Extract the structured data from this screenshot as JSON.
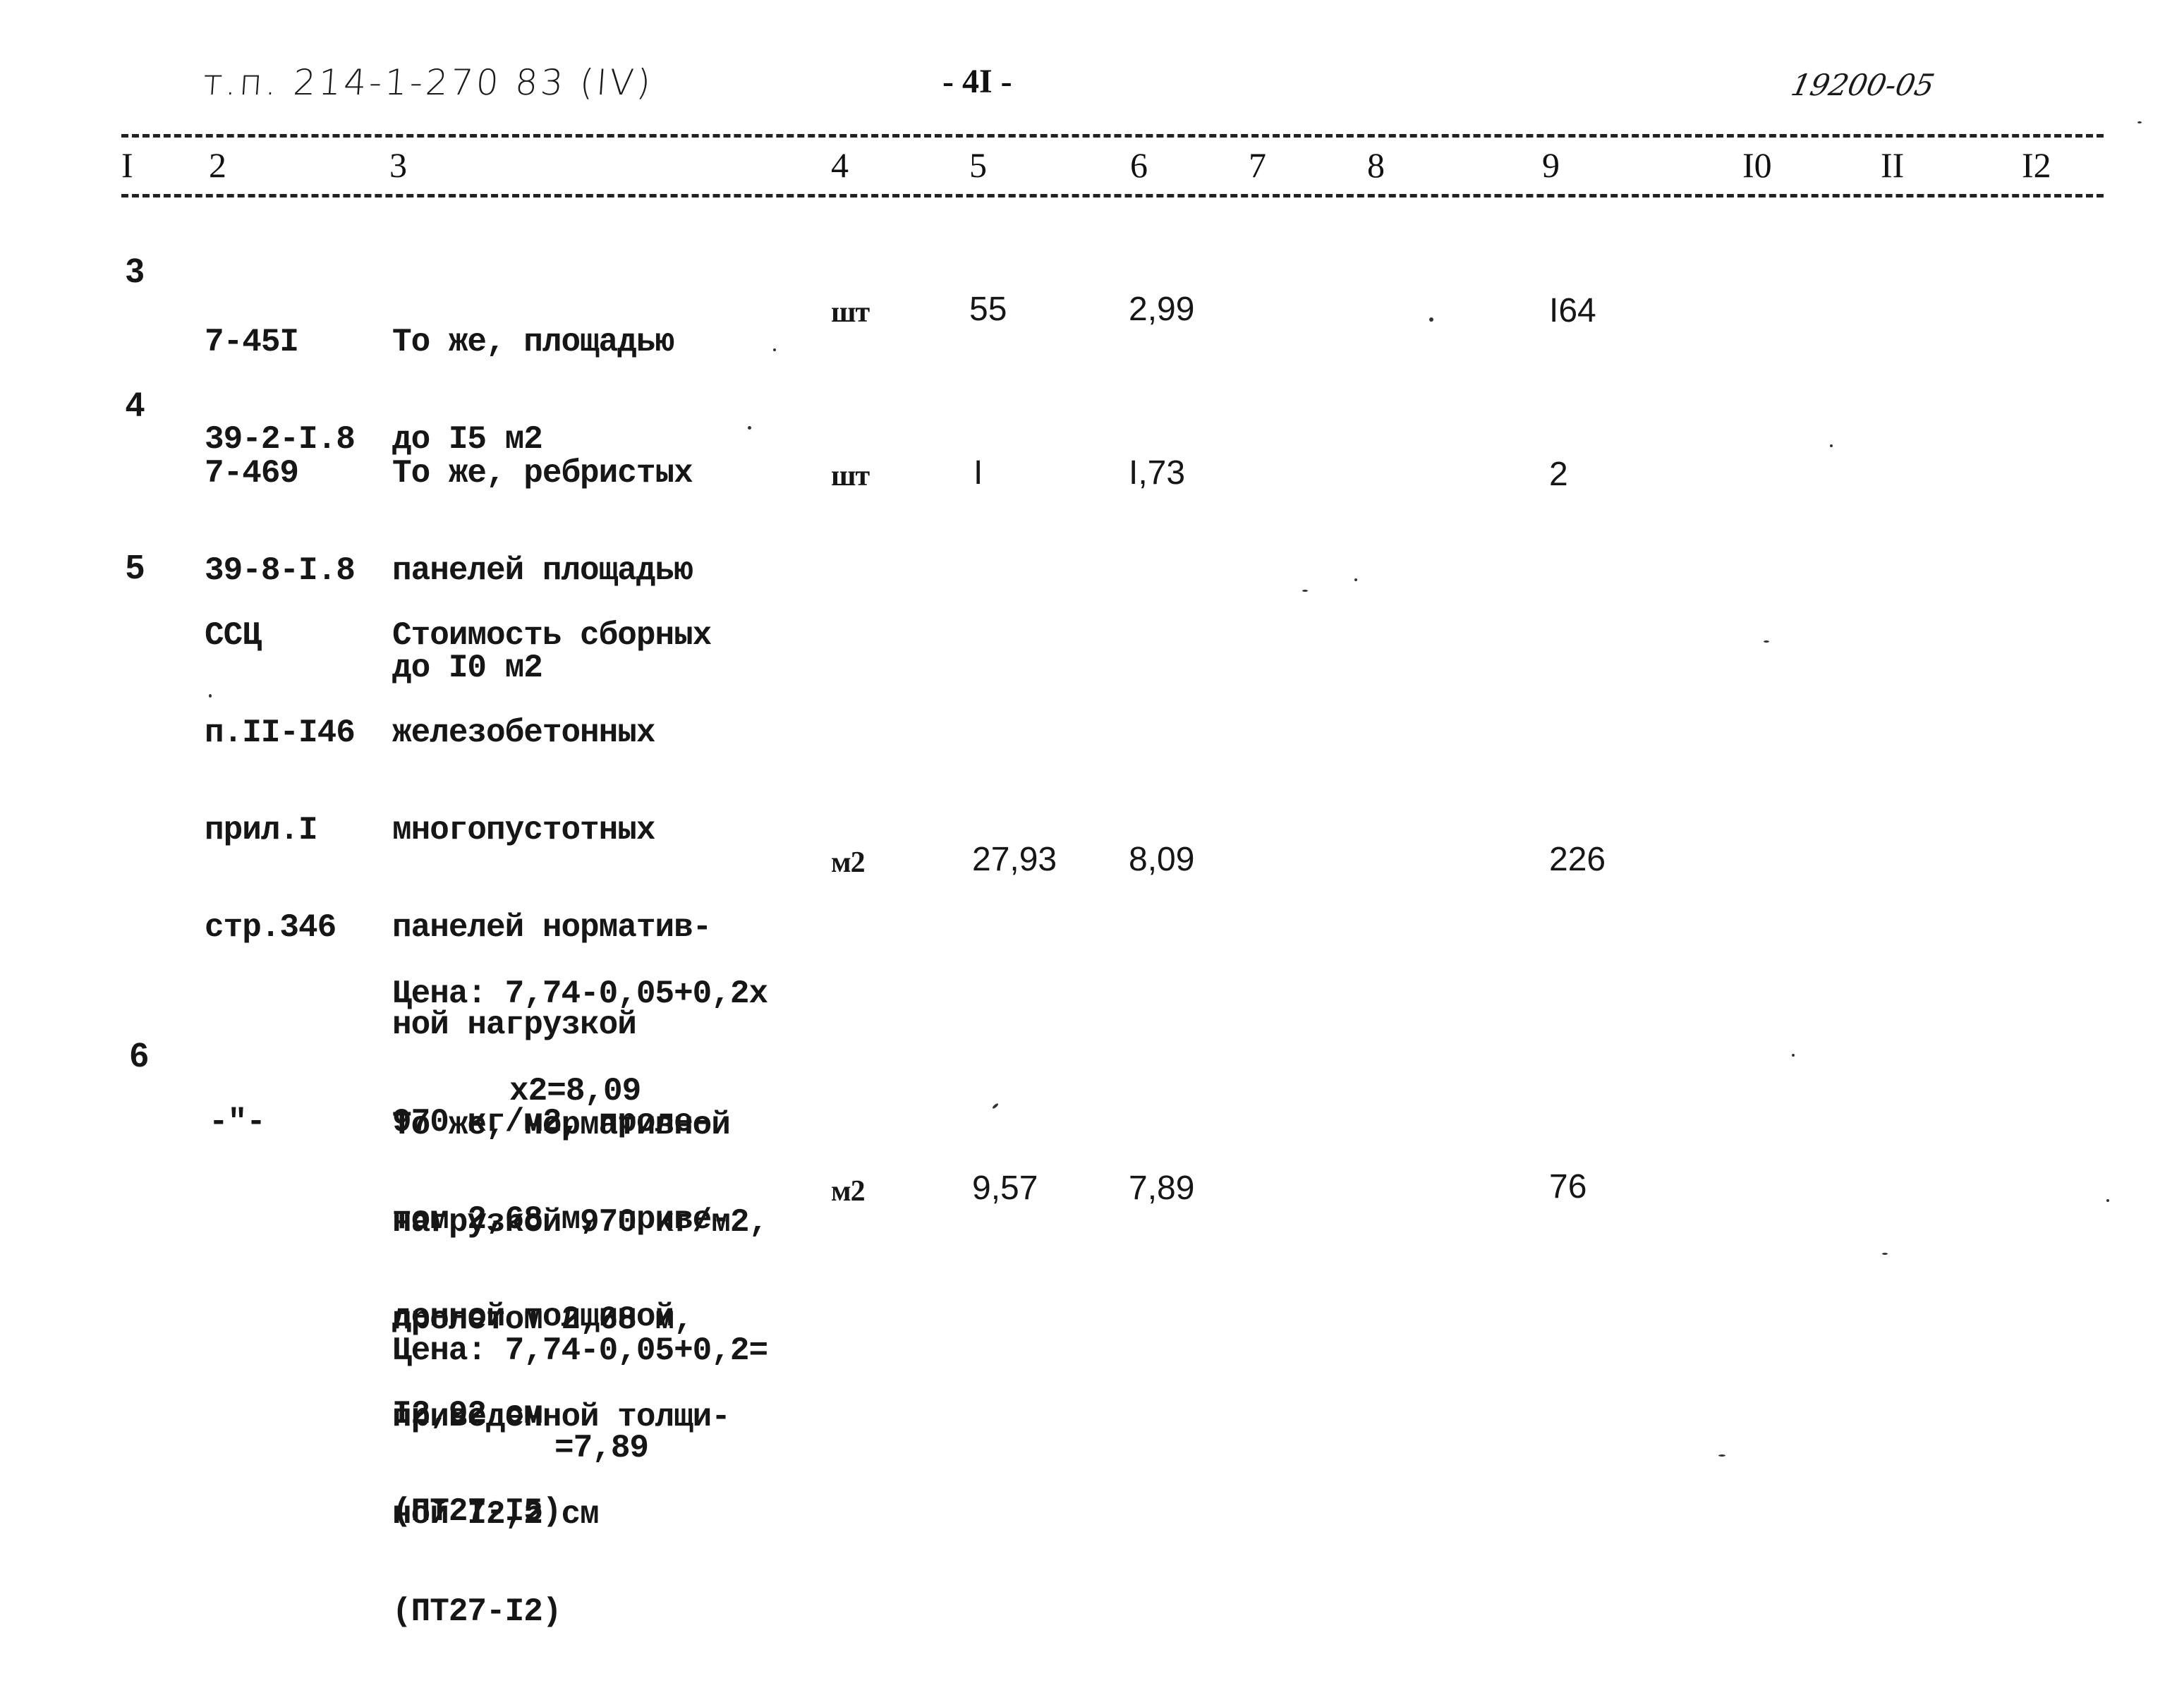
{
  "header": {
    "project_ref": "т.п. 214-1-270 83 (IV)",
    "page_number": "- 4I -",
    "doc_code": "19200-05"
  },
  "columns": [
    "I",
    "2",
    "3",
    "4",
    "5",
    "6",
    "7",
    "8",
    "9",
    "I0",
    "II",
    "I2"
  ],
  "rows": [
    {
      "num": "3",
      "code": [
        "7-45I",
        "39-2-I.8"
      ],
      "description": [
        "То же, площадью",
        "до I5 м2"
      ],
      "unit": "шт",
      "quantity": "55",
      "unit_price": "2,99",
      "col7": "",
      "col8": "",
      "total": "I64",
      "col10": "",
      "col11": "",
      "col12": ""
    },
    {
      "num": "4",
      "code": [
        "7-469",
        "39-8-I.8"
      ],
      "description": [
        "То же, ребристых",
        "панелей площадью",
        "до I0 м2"
      ],
      "unit": "шт",
      "quantity": "I",
      "unit_price": "I,73",
      "col7": "",
      "col8": "",
      "total": "2",
      "col10": "",
      "col11": "",
      "col12": ""
    },
    {
      "num": "5",
      "code": [
        "ССЦ",
        "п.II-I46",
        "прил.I",
        "стр.346"
      ],
      "description": [
        "Стоимость сборных",
        "железобетонных",
        "многопустотных",
        "панелей норматив-",
        "ной нагрузкой",
        "970 кг/м2, проле-",
        "том 2,68 м, приве-",
        "денной толщиной",
        "I2,92 см",
        "(ПТ27-I5)"
      ],
      "price_note": [
        "Цена: 7,74-0,05+0,2х",
        "х2=8,09"
      ],
      "unit": "м2",
      "quantity": "27,93",
      "unit_price": "8,09",
      "col7": "",
      "col8": "",
      "total": "226",
      "col10": "",
      "col11": "",
      "col12": ""
    },
    {
      "num": "6",
      "code": [
        "-\"-"
      ],
      "description": [
        "То же, нормативной",
        "нагрузкой 970 кг/м2,",
        "пролетом 2,68 м,",
        "приведенной толщи-",
        "ной I2,2 см",
        "(ПТ27-I2)"
      ],
      "price_note": [
        "Цена: 7,74-0,05+0,2=",
        "=7,89"
      ],
      "unit": "м2",
      "quantity": "9,57",
      "unit_price": "7,89",
      "col7": "",
      "col8": "",
      "total": "76",
      "col10": "",
      "col11": "",
      "col12": ""
    }
  ]
}
